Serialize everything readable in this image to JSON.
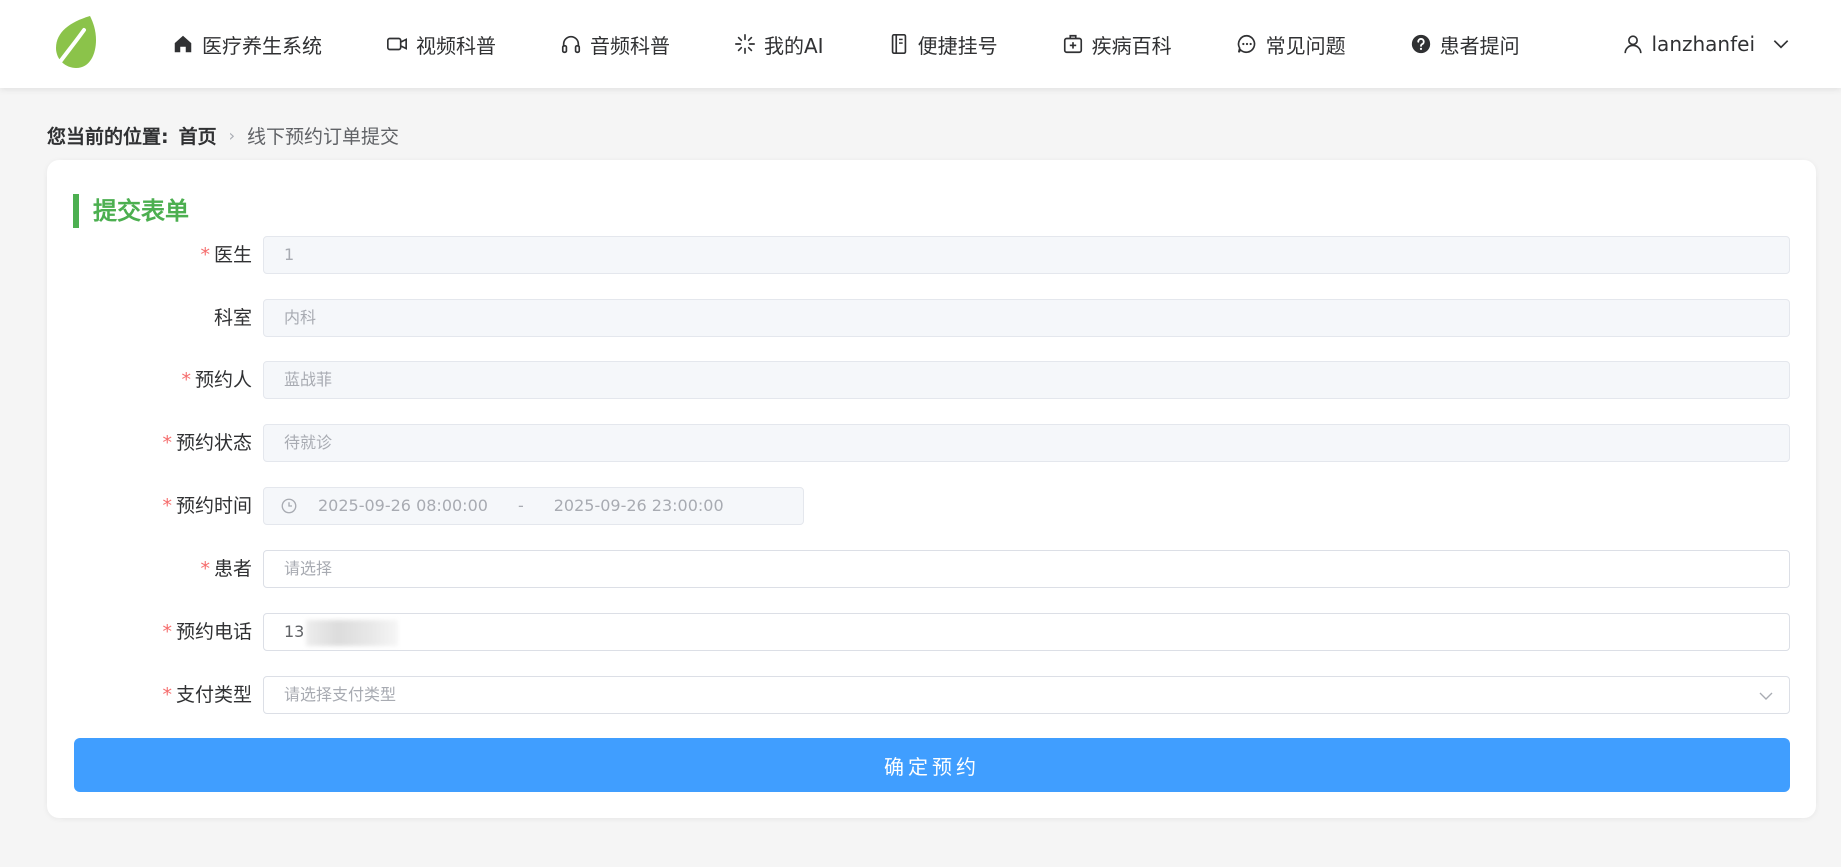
{
  "nav": {
    "items": [
      {
        "label": "医疗养生系统",
        "icon": "home-icon"
      },
      {
        "label": "视频科普",
        "icon": "video-camera-icon"
      },
      {
        "label": "音频科普",
        "icon": "headphones-icon"
      },
      {
        "label": "我的AI",
        "icon": "sparkle-icon"
      },
      {
        "label": "便捷挂号",
        "icon": "notebook-icon"
      },
      {
        "label": "疾病百科",
        "icon": "medical-kit-icon"
      },
      {
        "label": "常见问题",
        "icon": "chat-bubble-icon"
      },
      {
        "label": "患者提问",
        "icon": "question-circle-icon"
      }
    ],
    "username": "lanzhanfei"
  },
  "breadcrumb": {
    "label": "您当前的位置:",
    "home": "首页",
    "current": "线下预约订单提交"
  },
  "form": {
    "title": "提交表单",
    "fields": {
      "doctor": {
        "label": "医生",
        "value": "1",
        "required": true
      },
      "department": {
        "label": "科室",
        "value": "内科",
        "required": false
      },
      "booker": {
        "label": "预约人",
        "value": "蓝战菲",
        "required": true
      },
      "status": {
        "label": "预约状态",
        "value": "待就诊",
        "required": true
      },
      "time": {
        "label": "预约时间",
        "start": "2025-09-26 08:00:00",
        "separator": "-",
        "end": "2025-09-26 23:00:00",
        "required": true
      },
      "patient": {
        "label": "患者",
        "placeholder": "请选择",
        "required": true
      },
      "phone": {
        "label": "预约电话",
        "value": "13",
        "required": true
      },
      "payment": {
        "label": "支付类型",
        "placeholder": "请选择支付类型",
        "required": true
      }
    },
    "submit_label": "确定预约"
  },
  "colors": {
    "accent": "#4caf50",
    "primary": "#409eff",
    "required": "#f56c6c"
  }
}
